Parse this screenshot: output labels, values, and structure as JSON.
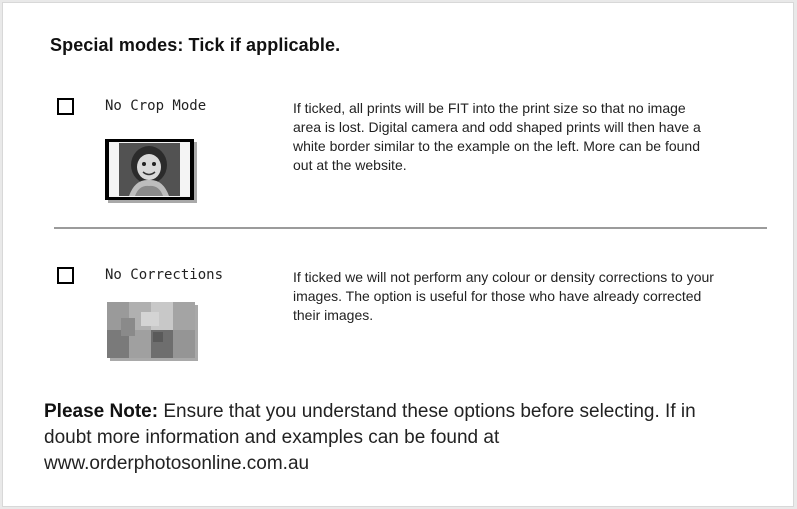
{
  "heading": "Special modes: Tick if applicable.",
  "options": [
    {
      "label": "No Crop Mode",
      "checked": false,
      "description": "If ticked, all prints will be FIT into the print size so that no image area is lost. Digital camera and odd shaped prints will then have a white border similar to the example on the left. More can be found out at the website.",
      "thumbnail_icon": "child-photo-thumbnail"
    },
    {
      "label": "No Corrections",
      "checked": false,
      "description": "If ticked we will not perform any colour or density corrections to your images. The option is useful for those who have already corrected their images.",
      "thumbnail_icon": "grey-swatch-thumbnail"
    }
  ],
  "note": {
    "label": "Please Note:",
    "text": " Ensure that you understand these options before selecting. If in doubt more information and examples can be found at www.orderphotosonline.com.au"
  }
}
